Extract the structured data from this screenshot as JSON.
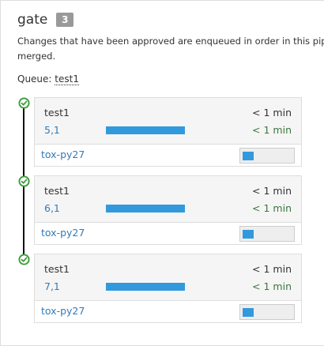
{
  "pipeline": {
    "name": "gate",
    "count": "3",
    "description_line1": "Changes that have been approved are enqueued in order in this pipeline and, if they pass tests, will be",
    "description_line2": "merged.",
    "queue_label": "Queue:",
    "queue_name": "test1"
  },
  "status_icon": "check-circle-icon",
  "colors": {
    "success": "#3c9c3c",
    "progress": "#3399dd",
    "link": "#337ab7",
    "enqueue_time": "#3c763d"
  },
  "changes": [
    {
      "project": "test1",
      "id": "5,1",
      "remaining": "< 1 min",
      "enqueued": "< 1 min",
      "progress": 1.0,
      "jobs": [
        {
          "name": "tox-py27",
          "progress": 0.22
        }
      ]
    },
    {
      "project": "test1",
      "id": "6,1",
      "remaining": "< 1 min",
      "enqueued": "< 1 min",
      "progress": 1.0,
      "jobs": [
        {
          "name": "tox-py27",
          "progress": 0.22
        }
      ]
    },
    {
      "project": "test1",
      "id": "7,1",
      "remaining": "< 1 min",
      "enqueued": "< 1 min",
      "progress": 1.0,
      "jobs": [
        {
          "name": "tox-py27",
          "progress": 0.22
        }
      ]
    }
  ]
}
